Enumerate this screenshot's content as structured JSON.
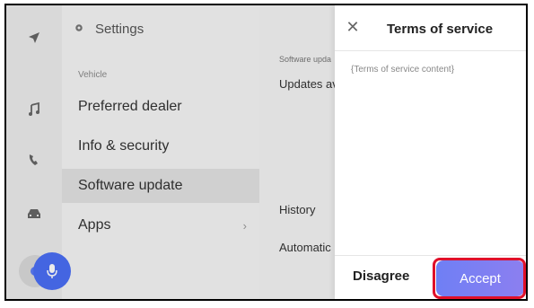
{
  "rail": {
    "icons": [
      "navigation-icon",
      "music-icon",
      "phone-icon",
      "car-icon",
      "settings-icon"
    ]
  },
  "settings_menu": {
    "title": "Settings",
    "section": "Vehicle",
    "items": [
      {
        "label": "Preferred dealer"
      },
      {
        "label": "Info & security"
      },
      {
        "label": "Software update"
      },
      {
        "label": "Apps"
      }
    ]
  },
  "content": {
    "section": "Software upda",
    "updates": "Updates av",
    "history": "History",
    "automatic": "Automatic"
  },
  "dialog": {
    "title": "Terms of service",
    "body": "{Terms of service content}",
    "disagree": "Disagree",
    "accept": "Accept"
  },
  "colors": {
    "accent": "#5b7bf6",
    "highlight": "#e0102a"
  }
}
